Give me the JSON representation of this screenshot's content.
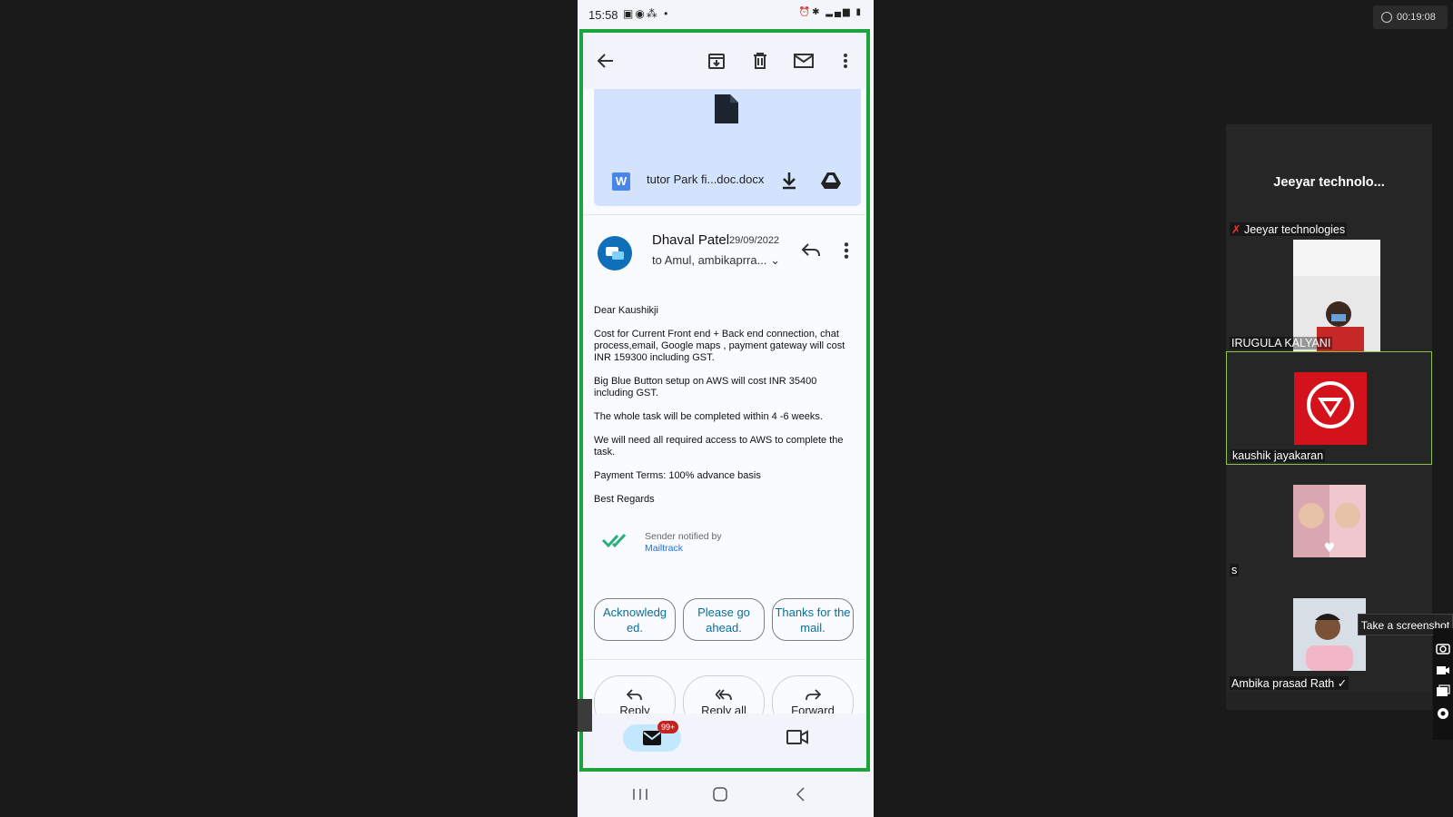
{
  "status_bar": {
    "time": "15:58"
  },
  "toolbar": {
    "back": "back-arrow-icon",
    "archive": "archive-icon",
    "delete": "trash-icon",
    "mark_unread": "mail-icon",
    "more": "more-vert-icon"
  },
  "attachment": {
    "filename": "tutor Park fi...doc.docx",
    "type_badge": "W"
  },
  "email": {
    "sender_name": "Dhaval Patel",
    "date": "29/09/2022",
    "to": "to Amul, ambikaprra...",
    "body": [
      "Dear Kaushikji",
      "Cost for Current Front end + Back end connection, chat process,email, Google maps , payment gateway will cost INR 159300 including GST.",
      "Big Blue Button setup on AWS will cost INR 35400 including GST.",
      "The whole task will be completed within 4 -6 weeks.",
      "We will need all required access to AWS to complete the task.",
      "Payment Terms: 100% advance basis",
      "Best Regards"
    ],
    "mailtrack_text": "Sender notified by",
    "mailtrack_link": "Mailtrack"
  },
  "smart_replies": [
    "Acknowledg ed.",
    "Please go ahead.",
    "Thanks for the mail."
  ],
  "actions": {
    "reply": "Reply",
    "reply_all": "Reply all",
    "forward": "Forward"
  },
  "bottom_nav": {
    "mail_badge": "99+"
  },
  "meeting": {
    "timer": "00:19:08",
    "host_title": "Jeeyar  technolo...",
    "participants": [
      {
        "name": "Jeeyar technologies"
      },
      {
        "name": "IRUGULA KALYANI"
      },
      {
        "name": "kaushik jayakaran"
      },
      {
        "name": "s"
      },
      {
        "name": "Ambika prasad Rath"
      }
    ],
    "tooltip": "Take a screenshot"
  },
  "colors": {
    "frame_border": "#1ca43a",
    "attachment_bg": "#d3e3fd",
    "chip_text": "#0b6e9b",
    "link": "#1a73e8",
    "active_tile_border": "#8bc34a"
  }
}
